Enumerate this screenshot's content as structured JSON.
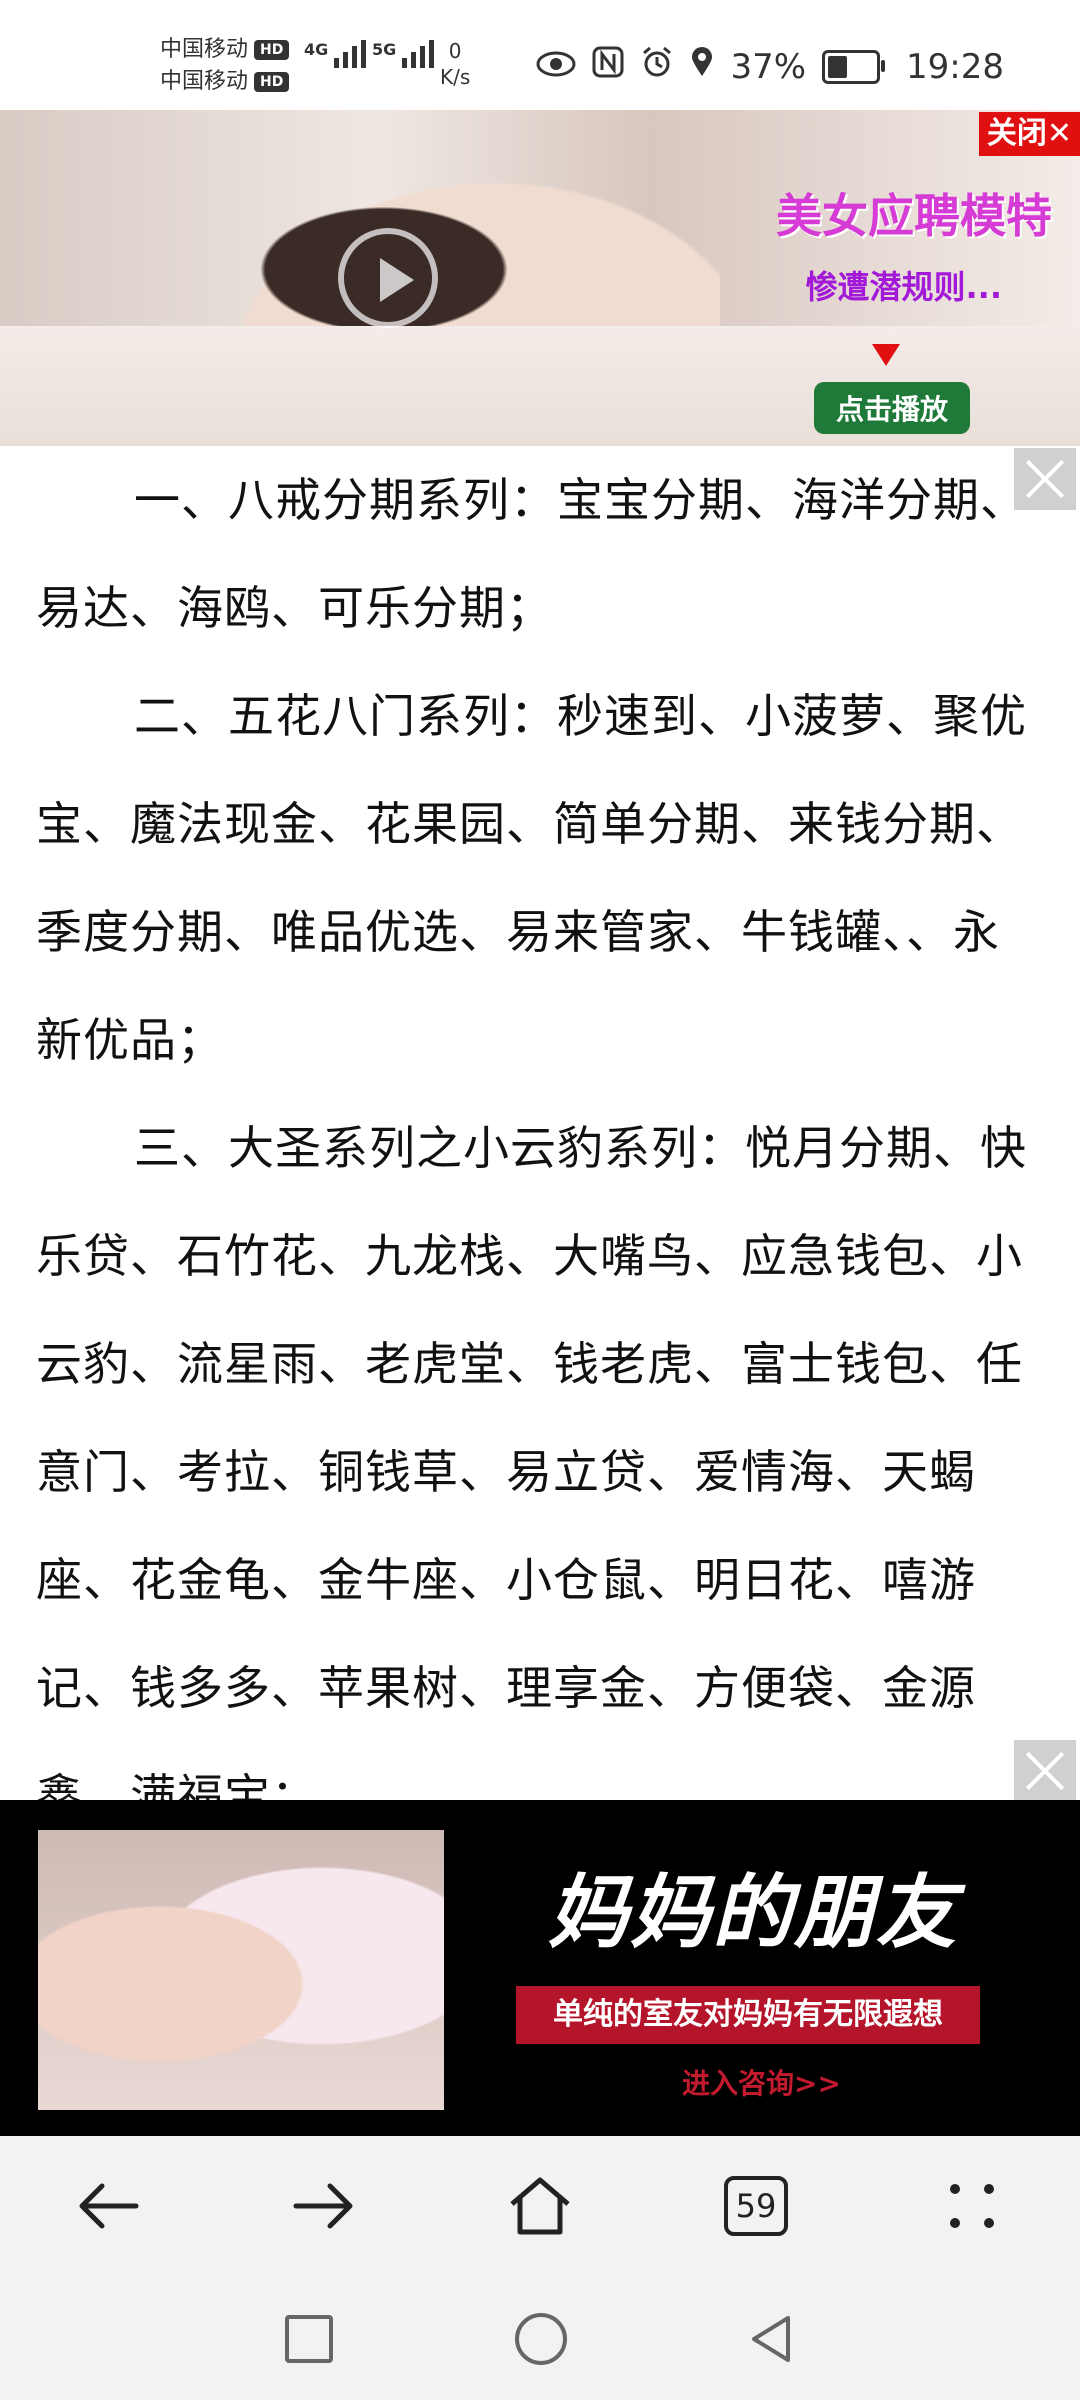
{
  "status_bar": {
    "carrier_1": "中国移动",
    "carrier_2": "中国移动",
    "hd": "HD",
    "net_4g": "4G",
    "net_5g": "5G",
    "net_speed_value": "0",
    "net_speed_unit": "K/s",
    "battery": "37%",
    "time": "19:28",
    "icons": [
      "eye-icon",
      "nfc-icon",
      "alarm-icon",
      "location-icon",
      "battery-icon"
    ]
  },
  "top_ad": {
    "close_label": "关闭✕",
    "title": "美女应聘模特",
    "subtitle": "惨遭潜规则...",
    "play_label": "点击播放"
  },
  "article": {
    "paragraphs": [
      "一、八戒分期系列：宝宝分期、海洋分期、易达、海鸥、可乐分期；",
      "二、五花八门系列：秒速到、小菠萝、聚优宝、魔法现金、花果园、简单分期、来钱分期、季度分期、唯品优选、易来管家、牛钱罐、、永新优品；",
      "三、大圣系列之小云豹系列：悦月分期、快乐贷、石竹花、九龙栈、大嘴鸟、应急钱包、小云豹、流星雨、老虎堂、钱老虎、富士钱包、任意门、考拉、铜钱草、易立贷、爱情海、天蝎座、花金龟、金牛座、小仓鼠、明日花、嘻游记、钱多多、苹果树、理享金、方便袋、金源鑫、满福宝；"
    ]
  },
  "bottom_ad": {
    "title": "妈妈的朋友",
    "subtitle": "单纯的室友对妈妈有无限遐想",
    "link": "进入咨询>>"
  },
  "toolbar": {
    "back": "←",
    "forward": "→",
    "home": "⌂",
    "tabs_count": "59"
  },
  "colors": {
    "ad_red": "#e01010",
    "ad_magenta": "#d63bd6",
    "ad_purple": "#a21ad8",
    "play_green": "#1f7a3a",
    "ad2_red": "#b5152a"
  }
}
